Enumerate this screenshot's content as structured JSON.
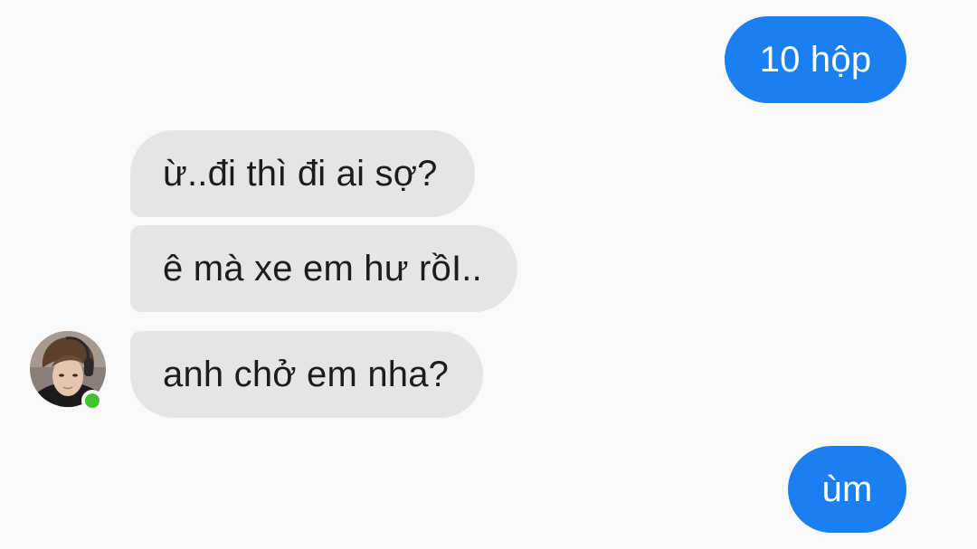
{
  "messages": [
    {
      "sender": "me",
      "text": "10 hộp"
    },
    {
      "sender": "contact",
      "text": "ừ..đi thì đi ai sợ?"
    },
    {
      "sender": "contact",
      "text": "ê mà xe em hư rồI.."
    },
    {
      "sender": "contact",
      "text": "anh chở em nha?"
    },
    {
      "sender": "me",
      "text": "ùm"
    }
  ],
  "contact": {
    "online": true
  },
  "colors": {
    "background": "#f9f9f9",
    "outgoing_bubble": "#1a7ff0",
    "incoming_bubble": "#e5e5e5",
    "incoming_text": "#1c1c1c",
    "online_indicator": "#42c02f"
  }
}
